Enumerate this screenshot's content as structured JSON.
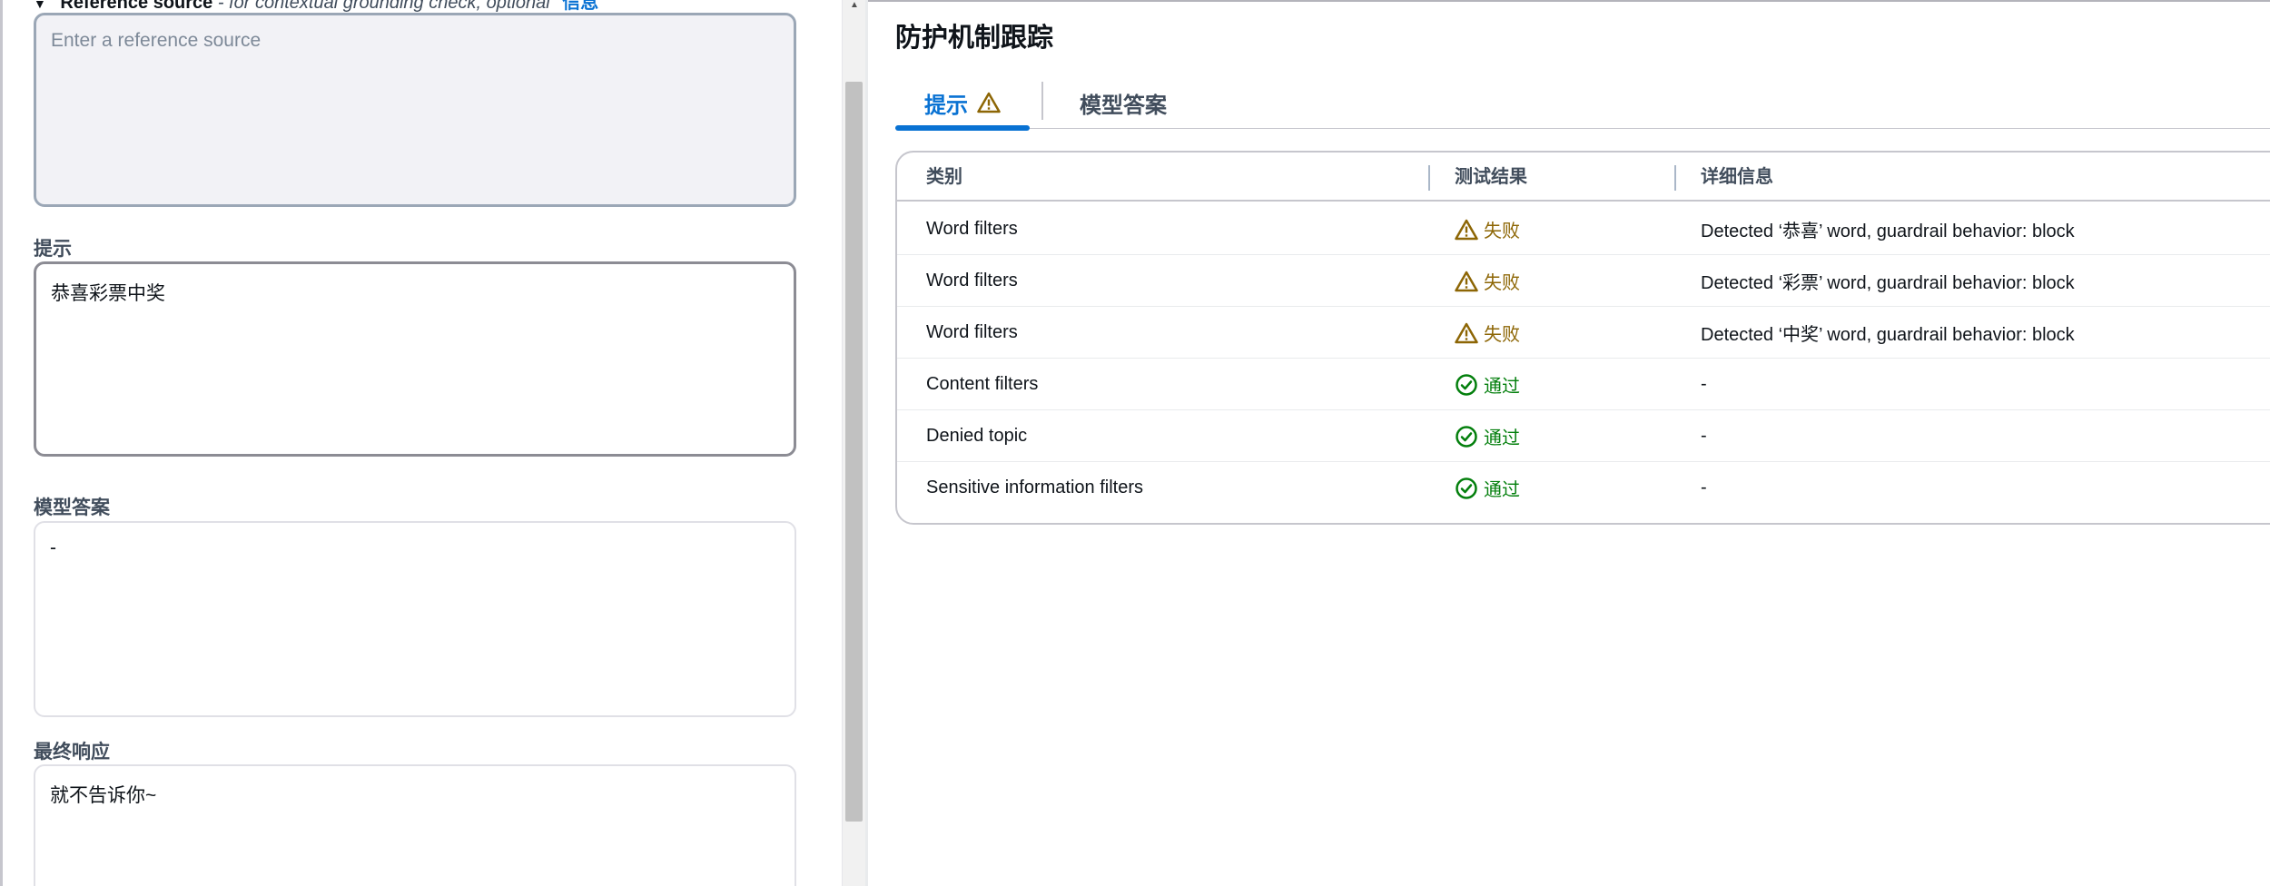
{
  "left_panel": {
    "reference_source": {
      "title": "Reference source",
      "description": "- for contextual grounding check, optional",
      "info_link": "信息",
      "placeholder": "Enter a reference source"
    },
    "prompt": {
      "label": "提示",
      "value": "恭喜彩票中奖"
    },
    "model_answer": {
      "label": "模型答案",
      "value": "-"
    },
    "final_response": {
      "label": "最终响应",
      "value": "就不告诉你~"
    }
  },
  "right_panel": {
    "title": "防护机制跟踪",
    "tabs": [
      {
        "label": "提示",
        "active": true,
        "warning": true
      },
      {
        "label": "模型答案",
        "active": false,
        "warning": false
      }
    ],
    "table": {
      "headers": [
        "类别",
        "测试结果",
        "详细信息"
      ],
      "rows": [
        {
          "category": "Word filters",
          "result": "失败",
          "status": "fail",
          "details": "Detected ‘恭喜’ word, guardrail behavior: block"
        },
        {
          "category": "Word filters",
          "result": "失败",
          "status": "fail",
          "details": "Detected ‘彩票’ word, guardrail behavior: block"
        },
        {
          "category": "Word filters",
          "result": "失败",
          "status": "fail",
          "details": "Detected ‘中奖’ word, guardrail behavior: block"
        },
        {
          "category": "Content filters",
          "result": "通过",
          "status": "pass",
          "details": "-"
        },
        {
          "category": "Denied topic",
          "result": "通过",
          "status": "pass",
          "details": "-"
        },
        {
          "category": "Sensitive information filters",
          "result": "通过",
          "status": "pass",
          "details": "-"
        }
      ]
    }
  },
  "colors": {
    "accent": "#0972d3",
    "fail": "#8d6605",
    "pass": "#037f0c"
  }
}
